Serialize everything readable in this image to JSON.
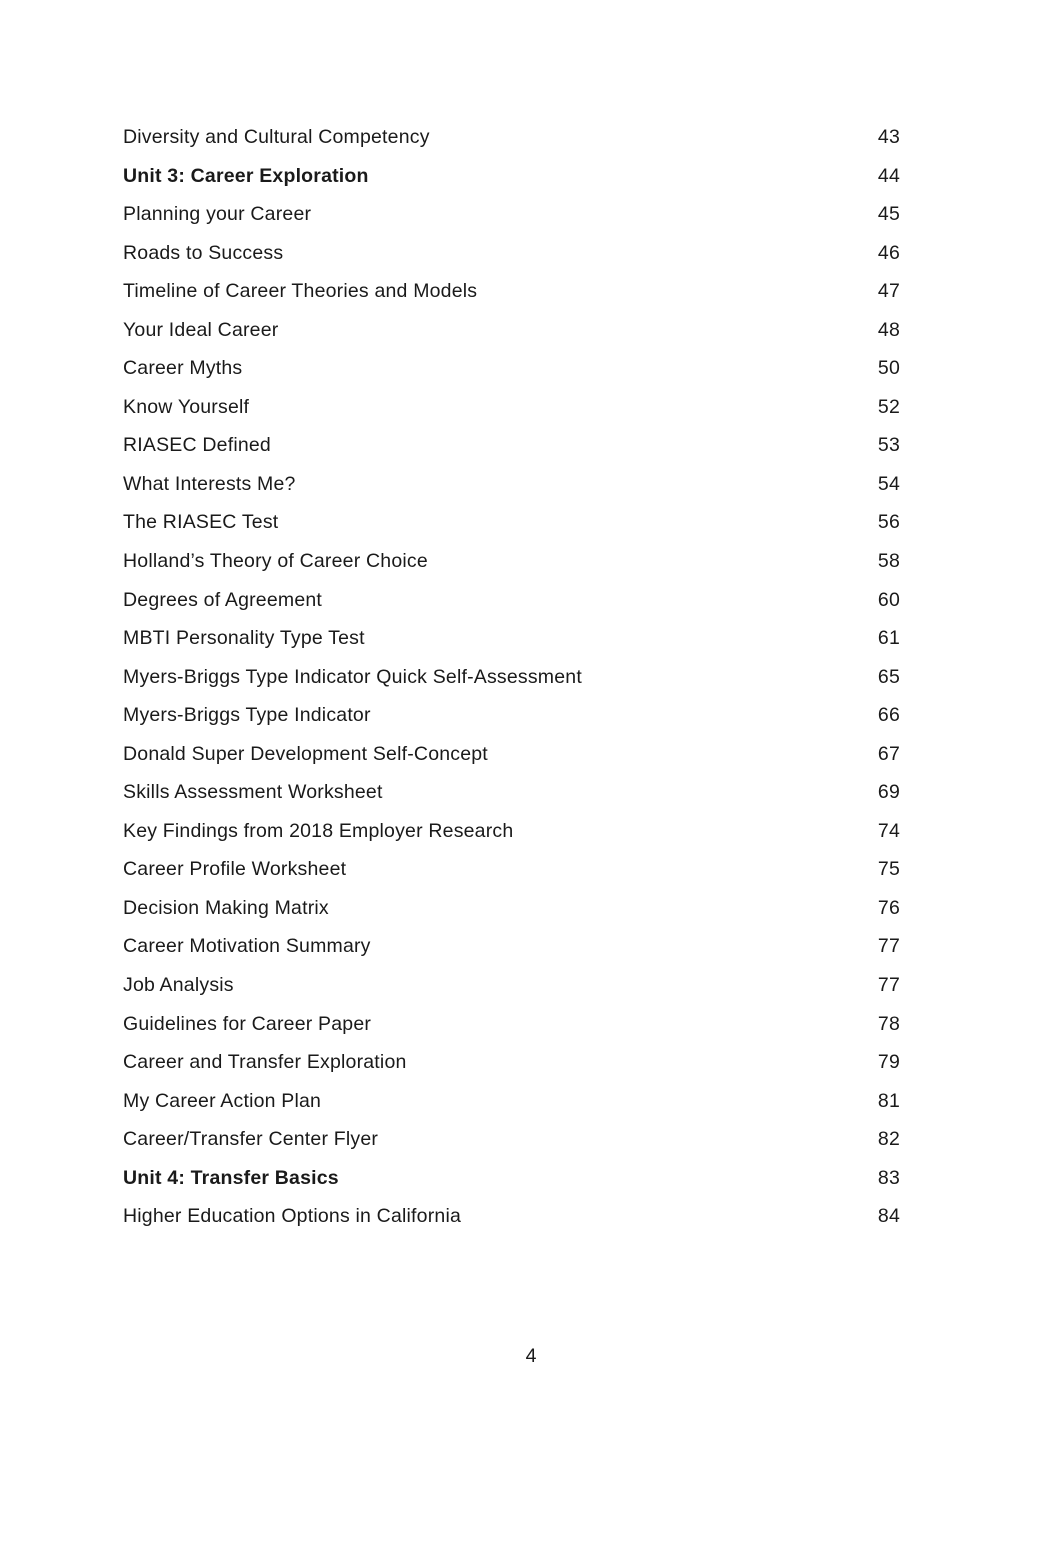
{
  "document": {
    "type": "table-of-contents",
    "folio": "4"
  },
  "toc": {
    "entries": [
      {
        "title": "Diversity and Cultural Competency",
        "page": "43",
        "bold": false
      },
      {
        "title": "Unit 3: Career Exploration",
        "page": "44",
        "bold": true
      },
      {
        "title": "Planning your Career",
        "page": "45",
        "bold": false
      },
      {
        "title": "Roads to Success",
        "page": "46",
        "bold": false
      },
      {
        "title": "Timeline of Career Theories and Models",
        "page": "47",
        "bold": false
      },
      {
        "title": "Your Ideal Career",
        "page": "48",
        "bold": false
      },
      {
        "title": "Career Myths",
        "page": "50",
        "bold": false
      },
      {
        "title": "Know Yourself",
        "page": "52",
        "bold": false
      },
      {
        "title": "RIASEC Defined",
        "page": "53",
        "bold": false
      },
      {
        "title": "What Interests Me?",
        "page": "54",
        "bold": false
      },
      {
        "title": "The RIASEC Test",
        "page": "56",
        "bold": false
      },
      {
        "title": "Holland’s Theory of Career Choice",
        "page": "58",
        "bold": false
      },
      {
        "title": "Degrees of Agreement",
        "page": "60",
        "bold": false
      },
      {
        "title": "MBTI Personality Type Test",
        "page": "61",
        "bold": false
      },
      {
        "title": "Myers-Briggs Type Indicator Quick Self-Assessment",
        "page": "65",
        "bold": false
      },
      {
        "title": "Myers-Briggs Type Indicator",
        "page": "66",
        "bold": false
      },
      {
        "title": "Donald Super Development Self-Concept",
        "page": "67",
        "bold": false
      },
      {
        "title": "Skills Assessment Worksheet",
        "page": "69",
        "bold": false
      },
      {
        "title": "Key Findings from 2018 Employer Research",
        "page": "74",
        "bold": false
      },
      {
        "title": "Career Profile Worksheet",
        "page": "75",
        "bold": false
      },
      {
        "title": "Decision Making Matrix",
        "page": "76",
        "bold": false
      },
      {
        "title": "Career Motivation Summary",
        "page": "77",
        "bold": false
      },
      {
        "title": "Job Analysis",
        "page": "77",
        "bold": false
      },
      {
        "title": "Guidelines for Career Paper",
        "page": "78",
        "bold": false
      },
      {
        "title": "Career and Transfer Exploration",
        "page": "79",
        "bold": false
      },
      {
        "title": "My Career Action Plan",
        "page": "81",
        "bold": false
      },
      {
        "title": "Career/Transfer Center Flyer",
        "page": "82",
        "bold": false
      },
      {
        "title": "Unit 4: Transfer Basics",
        "page": "83",
        "bold": true
      },
      {
        "title": "Higher Education Options in California",
        "page": "84",
        "bold": false
      }
    ]
  }
}
